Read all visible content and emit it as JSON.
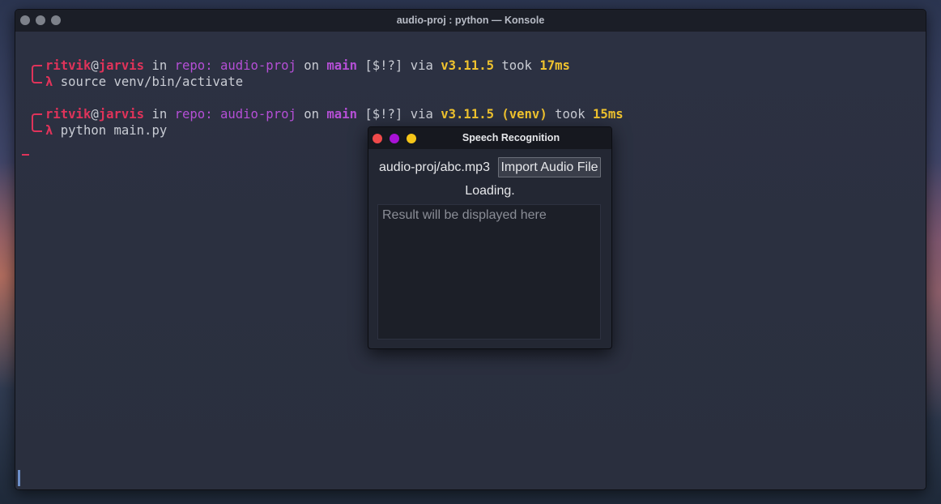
{
  "konsole": {
    "title": "audio-proj : python — Konsole",
    "button_color": "#7d818a"
  },
  "colors": {
    "prompt_red": "#e0335a",
    "repo_purple": "#b54fd6",
    "python_yellow": "#f0c32e",
    "text": "#c9ccd4",
    "dialog_close": "#ef4a4a",
    "dialog_minimize": "#a912d6",
    "dialog_maximize": "#f5c518"
  },
  "terminal": {
    "prompts": [
      {
        "user": "ritvik",
        "at": "@",
        "host": "jarvis",
        "in": " in ",
        "repo": "repo: audio-proj",
        "on": " on ",
        "branch_icon": "",
        "branch": "main",
        "status": " [$!?] ",
        "via": "via ",
        "py_icon": "",
        "py_version": "v3.11.5",
        "venv": "",
        "took": " took ",
        "duration": "17ms",
        "lambda": "λ",
        "command": " source venv/bin/activate"
      },
      {
        "user": "ritvik",
        "at": "@",
        "host": "jarvis",
        "in": " in ",
        "repo": "repo: audio-proj",
        "on": " on ",
        "branch_icon": "",
        "branch": "main",
        "status": " [$!?] ",
        "via": "via ",
        "py_icon": "",
        "py_version": "v3.11.5",
        "venv": " (venv)",
        "took": " took ",
        "duration": "15ms",
        "lambda": "λ",
        "command": " python main.py"
      }
    ]
  },
  "dialog": {
    "title": "Speech Recognition",
    "file_path": "audio-proj/abc.mp3",
    "import_button": "Import Audio File",
    "status": "Loading.",
    "result_placeholder": "Result will be displayed here",
    "result_value": ""
  }
}
